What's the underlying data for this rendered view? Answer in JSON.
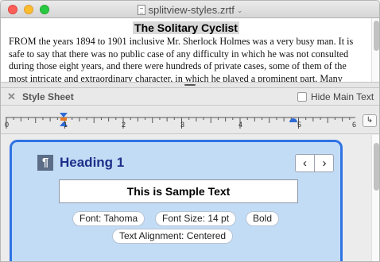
{
  "window": {
    "title": "splitview-styles.zrtf"
  },
  "document": {
    "heading": "The Solitary Cyclist",
    "body": "FROM the years 1894 to 1901 inclusive Mr. Sherlock Holmes was a very busy man. It is safe to say that there was no public case of any difficulty in which he was not consulted during those eight years, and there were hundreds of private cases, some of them of the most intricate and extraordinary character, in which he played a prominent part. Many"
  },
  "stylesheet": {
    "title": "Style Sheet",
    "hide_main_label": "Hide Main Text",
    "hide_main_checked": false
  },
  "ruler": {
    "numbers": [
      "0",
      "1",
      "2",
      "3",
      "4",
      "5",
      "6"
    ]
  },
  "style_card": {
    "icon": "paragraph-icon",
    "name": "Heading 1",
    "sample_text": "This is Sample Text",
    "attributes": {
      "font": "Font: Tahoma",
      "size": "Font Size: 14 pt",
      "weight": "Bold",
      "alignment": "Text Alignment: Centered"
    },
    "accent_color": "#2f73e4",
    "background_color": "#c3dcf6"
  }
}
